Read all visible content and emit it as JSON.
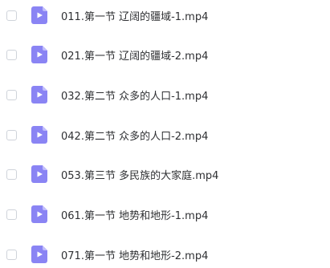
{
  "files": [
    {
      "name": "011.第一节 辽阔的疆域-1.mp4",
      "icon": "video-file-icon"
    },
    {
      "name": "021.第一节 辽阔的疆域-2.mp4",
      "icon": "video-file-icon"
    },
    {
      "name": "032.第二节 众多的人口-1.mp4",
      "icon": "video-file-icon"
    },
    {
      "name": "042.第二节 众多的人口-2.mp4",
      "icon": "video-file-icon"
    },
    {
      "name": "053.第三节 多民族的大家庭.mp4",
      "icon": "video-file-icon"
    },
    {
      "name": "061.第一节 地势和地形-1.mp4",
      "icon": "video-file-icon"
    },
    {
      "name": "071.第一节 地势和地形-2.mp4",
      "icon": "video-file-icon"
    }
  ],
  "colors": {
    "icon_fill": "#8a84f4",
    "icon_fold": "#c1bdfb",
    "text": "#2f3033",
    "checkbox_border": "#cfd3da"
  }
}
